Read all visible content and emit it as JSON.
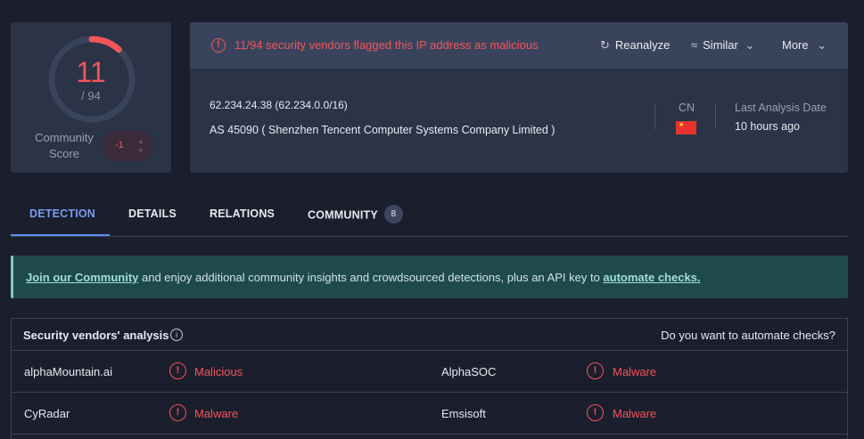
{
  "score": {
    "detections": "11",
    "total": "/ 94",
    "community_label": "Community Score",
    "community_vote": "-1",
    "gauge_fraction": 0.117,
    "gauge_color": "#f2555a"
  },
  "summary": {
    "alert_text": "11/94 security vendors flagged this IP address as malicious",
    "actions": {
      "reanalyze": "Reanalyze",
      "similar": "Similar",
      "more": "More"
    },
    "ip_line": "62.234.24.38  (62.234.0.0/16)",
    "as_line": "AS 45090  ( Shenzhen Tencent Computer Systems Company Limited )",
    "country_code": "CN",
    "last_analysis_label": "Last Analysis Date",
    "last_analysis_value": "10 hours ago"
  },
  "tabs": [
    {
      "label": "DETECTION",
      "active": true
    },
    {
      "label": "DETAILS",
      "active": false
    },
    {
      "label": "RELATIONS",
      "active": false
    },
    {
      "label": "COMMUNITY",
      "active": false,
      "badge": "8"
    }
  ],
  "banner": {
    "link1": "Join our Community",
    "middle": " and enjoy additional community insights and crowdsourced detections, plus an API key to ",
    "link2": "automate checks."
  },
  "vendors": {
    "title": "Security vendors' analysis",
    "cta": "Do you want to automate checks?",
    "rows": [
      {
        "left_name": "alphaMountain.ai",
        "left_result": "Malicious",
        "right_name": "AlphaSOC",
        "right_result": "Malware"
      },
      {
        "left_name": "CyRadar",
        "left_result": "Malware",
        "right_name": "Emsisoft",
        "right_result": "Malware"
      }
    ]
  },
  "colors": {
    "accent_red": "#f2555a",
    "accent_blue": "#5b8def",
    "banner_teal": "#1f4a4b"
  }
}
